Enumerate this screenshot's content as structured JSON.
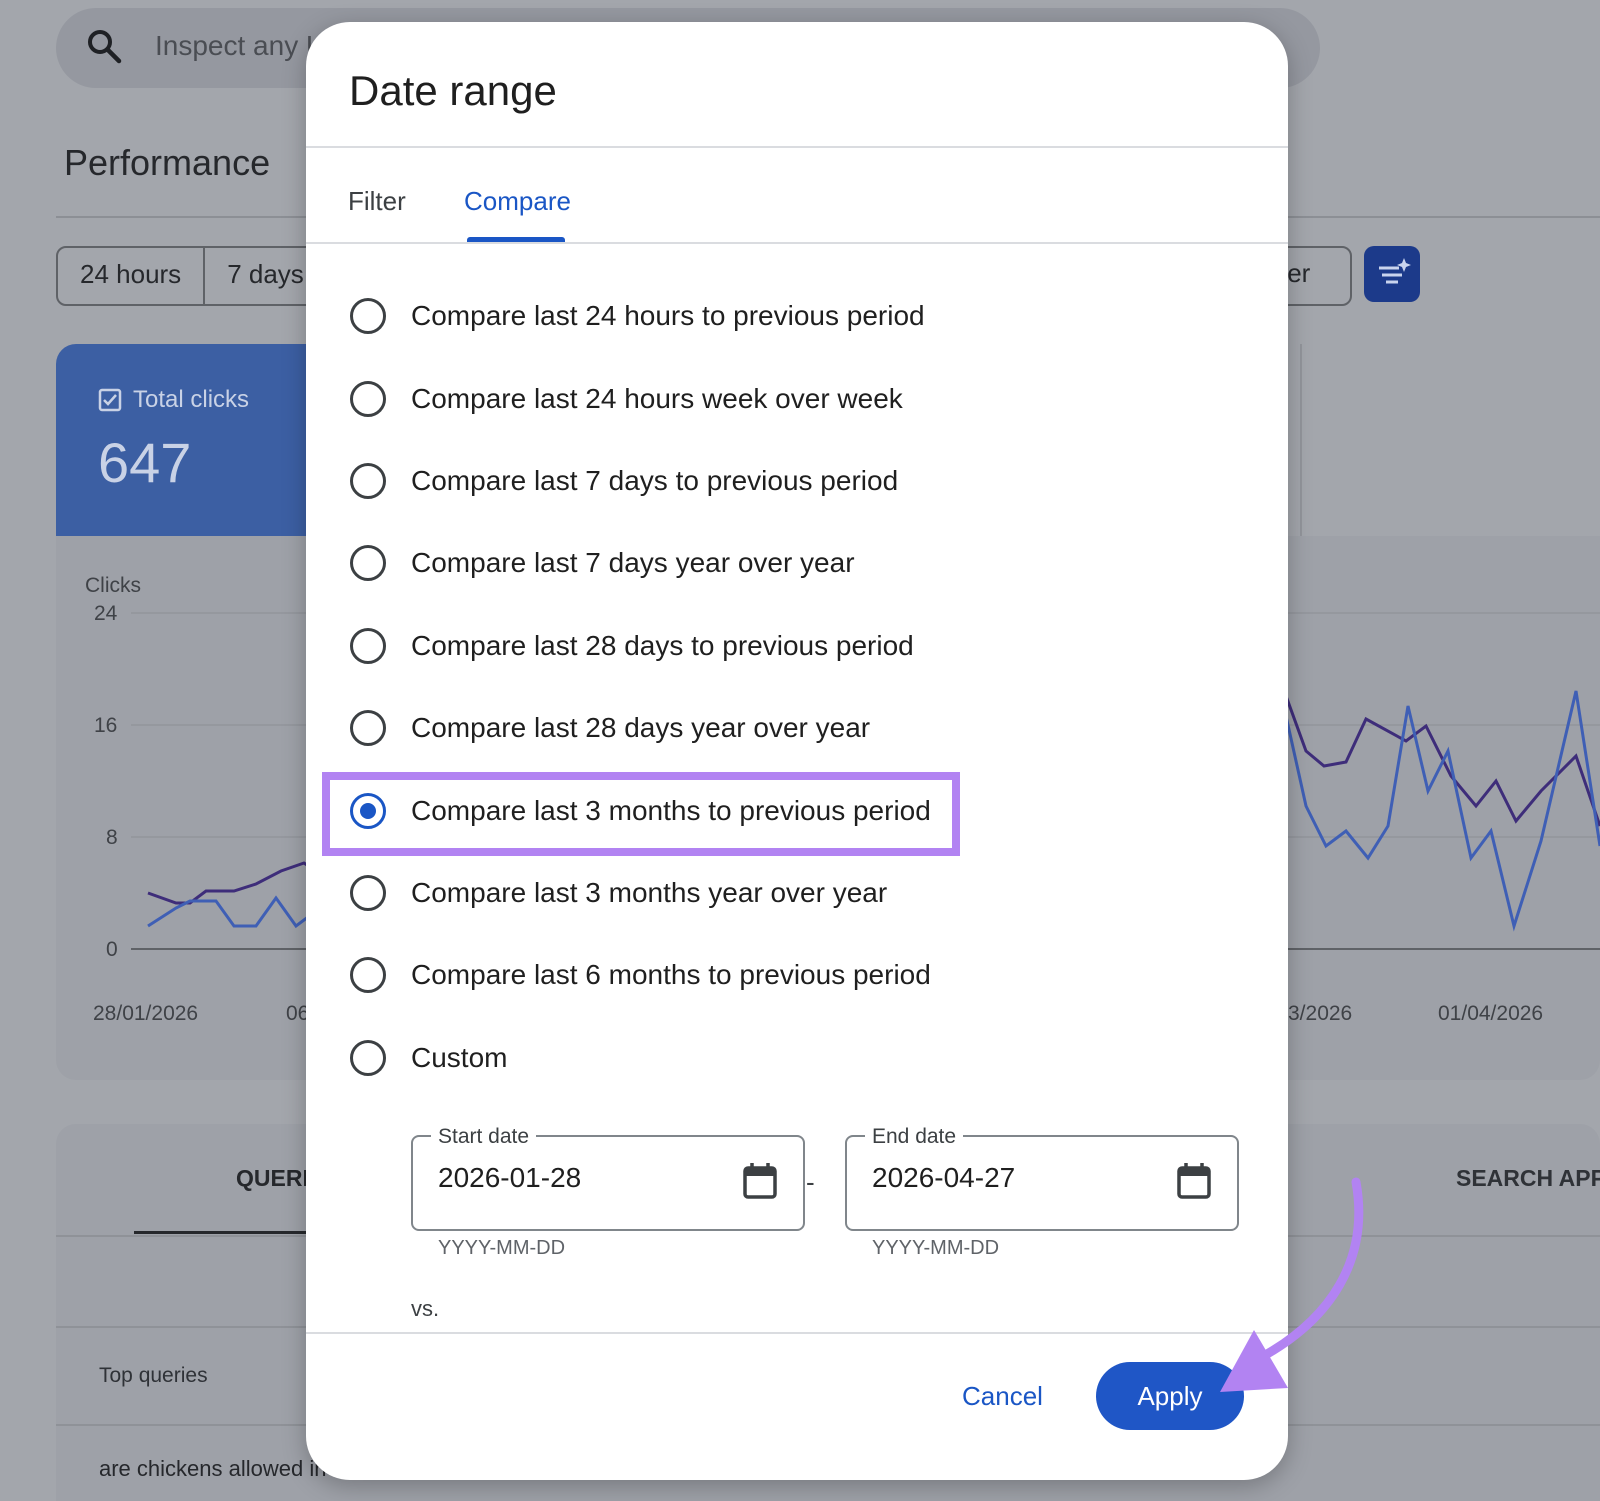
{
  "background": {
    "search_placeholder": "Inspect any U",
    "page_title": "Performance",
    "chips": [
      "24 hours",
      "7 days"
    ],
    "chip_right_partial": "ter",
    "metric_label": "Total clicks",
    "metric_value": "647",
    "chart_ylabel": "Clicks",
    "chart_yticks": [
      "24",
      "16",
      "8",
      "0"
    ],
    "chart_xticks_left": [
      "28/01/2026",
      "06"
    ],
    "chart_xticks_right": [
      "3/2026",
      "01/04/2026"
    ],
    "table_tab_active": "QUERI",
    "table_tab_right": "SEARCH APP",
    "table_header": "Top queries",
    "query_row": "are chickens allowed in"
  },
  "dialog": {
    "title": "Date range",
    "tabs": [
      {
        "label": "Filter",
        "active": false
      },
      {
        "label": "Compare",
        "active": true
      }
    ],
    "options": [
      {
        "label": "Compare last 24 hours to previous period",
        "selected": false
      },
      {
        "label": "Compare last 24 hours week over week",
        "selected": false
      },
      {
        "label": "Compare last 7 days to previous period",
        "selected": false
      },
      {
        "label": "Compare last 7 days year over year",
        "selected": false
      },
      {
        "label": "Compare last 28 days to previous period",
        "selected": false
      },
      {
        "label": "Compare last 28 days year over year",
        "selected": false
      },
      {
        "label": "Compare last 3 months to previous period",
        "selected": true
      },
      {
        "label": "Compare last 3 months year over year",
        "selected": false
      },
      {
        "label": "Compare last 6 months to previous period",
        "selected": false
      },
      {
        "label": "Custom",
        "selected": false
      }
    ],
    "start_date": {
      "label": "Start date",
      "value": "2026-01-28",
      "hint": "YYYY-MM-DD"
    },
    "end_date": {
      "label": "End date",
      "value": "2026-04-27",
      "hint": "YYYY-MM-DD"
    },
    "date_separator": "-",
    "vs_label": "vs.",
    "cancel_label": "Cancel",
    "apply_label": "Apply"
  },
  "colors": {
    "accent": "#1a56c5",
    "highlight": "#b283f2",
    "metric_card": "#3c5fa3"
  },
  "icons": {
    "search": "search-icon",
    "calendar": "calendar-icon",
    "filter": "filter-sparkle-icon",
    "checkbox": "checkbox-checked-icon"
  }
}
